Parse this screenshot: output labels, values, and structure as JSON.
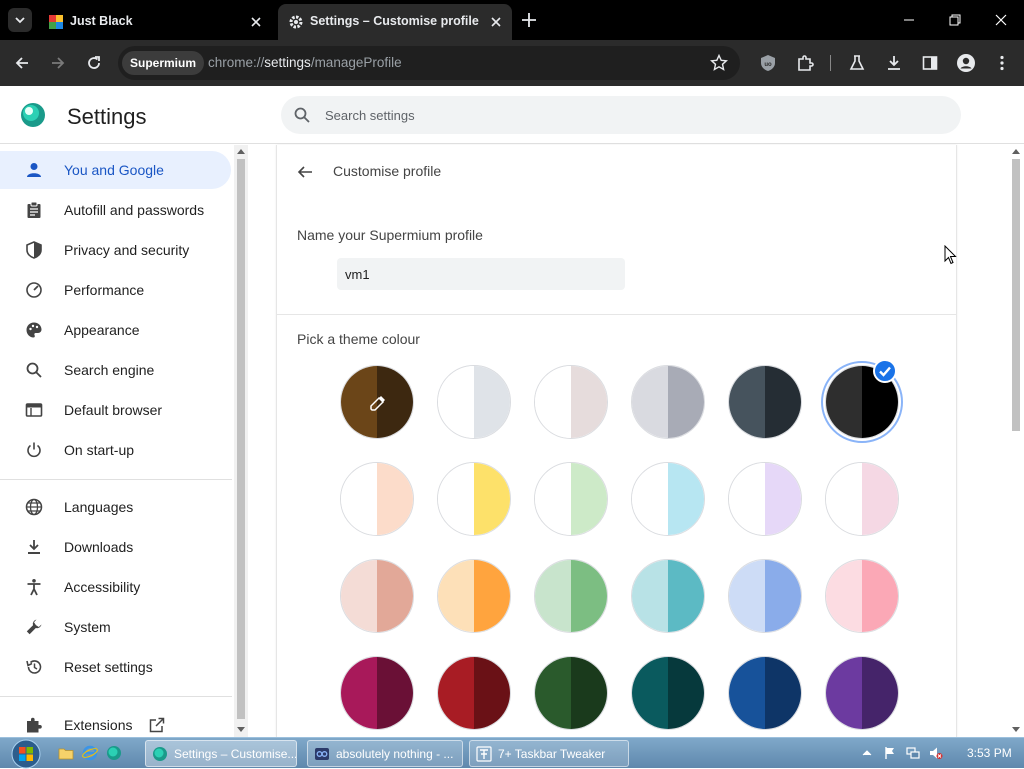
{
  "tabs": [
    {
      "title": "Just Black",
      "active": false
    },
    {
      "title": "Settings – Customise profile",
      "active": true
    }
  ],
  "toolbar": {
    "origin_chip": "Supermium",
    "url_scheme": "chrome://",
    "url_host": "settings",
    "url_path": "/manageProfile"
  },
  "header": {
    "title": "Settings",
    "search_placeholder": "Search settings"
  },
  "sidebar": {
    "items": [
      {
        "label": "You and Google",
        "icon": "person-icon",
        "selected": true
      },
      {
        "label": "Autofill and passwords",
        "icon": "clipboard-icon"
      },
      {
        "label": "Privacy and security",
        "icon": "shield-icon"
      },
      {
        "label": "Performance",
        "icon": "speedometer-icon"
      },
      {
        "label": "Appearance",
        "icon": "palette-icon"
      },
      {
        "label": "Search engine",
        "icon": "search-icon"
      },
      {
        "label": "Default browser",
        "icon": "browser-window-icon"
      },
      {
        "label": "On start-up",
        "icon": "power-icon"
      },
      {
        "label": "Languages",
        "icon": "globe-icon"
      },
      {
        "label": "Downloads",
        "icon": "download-icon"
      },
      {
        "label": "Accessibility",
        "icon": "accessibility-icon"
      },
      {
        "label": "System",
        "icon": "wrench-icon"
      },
      {
        "label": "Reset settings",
        "icon": "history-icon"
      },
      {
        "label": "Extensions",
        "icon": "puzzle-icon"
      }
    ]
  },
  "main": {
    "subpage_title": "Customise profile",
    "name_label": "Name your Supermium profile",
    "name_value": "vm1",
    "theme_label": "Pick a theme colour",
    "swatches": [
      {
        "left": "#6b4518",
        "right": "#3d2810",
        "custom": true
      },
      {
        "left": "#ffffff",
        "right": "#dfe3e8"
      },
      {
        "left": "#ffffff",
        "right": "#e6dcdc"
      },
      {
        "left": "#d9dae0",
        "right": "#a8abb6"
      },
      {
        "left": "#46535d",
        "right": "#252d34"
      },
      {
        "left": "#2e2e2e",
        "right": "#000000",
        "selected": true
      },
      {
        "left": "#ffffff",
        "right": "#fcdcca"
      },
      {
        "left": "#ffffff",
        "right": "#fde16a"
      },
      {
        "left": "#ffffff",
        "right": "#cdeac8"
      },
      {
        "left": "#ffffff",
        "right": "#b7e6f2"
      },
      {
        "left": "#ffffff",
        "right": "#e6d8f8"
      },
      {
        "left": "#ffffff",
        "right": "#f5d8e4"
      },
      {
        "left": "#f4dcd6",
        "right": "#e2a898"
      },
      {
        "left": "#fde0b8",
        "right": "#ffa43e"
      },
      {
        "left": "#c8e4cc",
        "right": "#7cbe82"
      },
      {
        "left": "#b8e2e6",
        "right": "#5cbac4"
      },
      {
        "left": "#cddcf6",
        "right": "#8aacea"
      },
      {
        "left": "#fcdce2",
        "right": "#fba8b6"
      },
      {
        "left": "#a8195a",
        "right": "#6a1036"
      },
      {
        "left": "#a81c24",
        "right": "#6a1116"
      },
      {
        "left": "#2a5a2c",
        "right": "#1a3a1c"
      },
      {
        "left": "#0a5a5e",
        "right": "#06393c"
      },
      {
        "left": "#17529a",
        "right": "#0e3567"
      },
      {
        "left": "#6c3aa0",
        "right": "#45246a"
      }
    ]
  },
  "taskbar": {
    "tasks": [
      {
        "label": "Settings – Customise...",
        "active": true
      },
      {
        "label": "absolutely nothing - ...",
        "active": false
      },
      {
        "label": "7+ Taskbar Tweaker",
        "active": false
      }
    ],
    "clock": "3:53 PM"
  }
}
